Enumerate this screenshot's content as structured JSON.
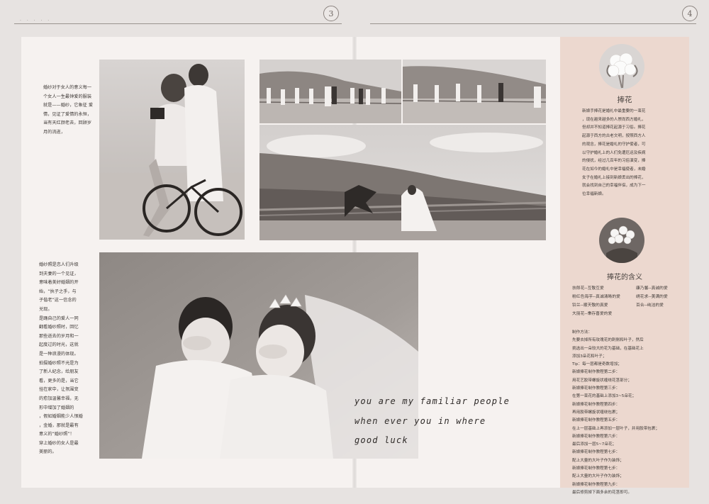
{
  "page_numbers": {
    "left": "3",
    "right": "4"
  },
  "left_top_text": "婚纱对于女人的意义每一\n个女人一生最钟爱的服装\n就是——婚纱，它象征 爱\n情，见证了爱情的永恒，\n当有天红颜老去，回顾岁\n月的流逝，",
  "left_bottom_text": "婚纱照是恋人们升级\n到夫妻的一个见证，\n意味着美好婚姻的开\n始，“执子之手，与\n子偕老”这一信念的\n兑现。\n是踊自己的爱人一同\n翻看婚纱照时，回忆\n那些逝去的岁月和一\n起度过的时光，这就\n是一种浪漫的体现。\n拍摄婚纱照不光是为\n了新人纪念，给朋友\n看，更多的是，当它\n挂在家中，让氛围变\n的愈加温馨幸福，无\n形中增加了婚姻的\n，假如婚姻能少人恨婚\n，金婚，那就是最有\n意义的“婚纱照”！\n穿上婚纱的女人是最\n美丽的。",
  "script_text": "you are my familiar people\nwhen ever you in where\ngood luck",
  "bouquet": {
    "title": "捧花",
    "body": "新娘手捧花是婚礼中最重要的一束花\n，现在越来越多的人崇尚西方婚礼，\n但却并不知道捧花起源于习俗。捧花\n起源于西方的古老文明，按照西方人\n的观念，捧花是婚礼的守护使者，可\n以守护婚礼上的人们免遭厄运及疾病\n的侵扰，经过几百年的习俗演变，捧\n花在如今的婚礼中是幸福使者，未婚\n女子在婚礼上接到新娘丢出的捧花，\n就会找到自己的幸福伴侣，成为下一\n位幸福新娘。"
  },
  "meaning": {
    "title": "捧花的含义",
    "rows": [
      [
        "扶郎花--互敬互爱",
        "康乃馨--真诚的爱"
      ],
      [
        "粉红色海芋--真诚清晰的爱",
        "绣花求--美满的爱"
      ],
      [
        "铃兰--顺天敬的真爱",
        "百合--纯洁的爱"
      ],
      [
        "大丽花--秉存喜爱的爱",
        ""
      ]
    ]
  },
  "steps_text": "制作方法：\n先要去掉所有玫瑰花的刺侧和叶子，然后\n挑选出一朵较大的花为基础，在基础花上\n添加3朵花和叶子；\nTip：每一层都是奇数增加；\n新娘捧花制作教程第二步：\n用花艺胶带螺旋状缠绕花茎部分；\n新娘捧花制作教程第三步：\n在第一束花的基础上添加3~5朵花；\n新娘捧花制作教程第四步：\n再用胶带螺旋状缠绕包裹；\n新娘捧花制作教程第五步：\n在上一层基础上再添加一层叶子，并用胶带包裹；\n新娘捧花制作教程第六步：\n最后添加一层5~7朵花；\n新娘捧花制作教程第七步：\n配上大量的大叶子作为装饰；\n新娘捧花制作教程第七步：\n配上大量的大叶子作为装饰；\n新娘捧花制作教程第九步：\n最后修剪掉下面多余的花茎即可。",
  "colors": {
    "panel": "#ecd8cf",
    "page": "#f6f2f0",
    "background": "#e7e3e1"
  }
}
